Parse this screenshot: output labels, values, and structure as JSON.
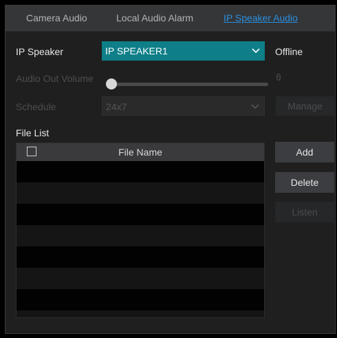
{
  "tabs": [
    {
      "label": "Camera Audio",
      "active": false
    },
    {
      "label": "Local Audio Alarm",
      "active": false
    },
    {
      "label": "IP Speaker Audio",
      "active": true
    }
  ],
  "ip_speaker": {
    "label": "IP Speaker",
    "value": "IP SPEAKER1",
    "status": "Offline"
  },
  "volume": {
    "label": "Audio Out Volume",
    "value": "0",
    "level_fraction": 0
  },
  "schedule": {
    "label": "Schedule",
    "value": "24x7",
    "manage_label": "Manage"
  },
  "file_list": {
    "label": "File List",
    "column_header": "File Name",
    "rows": [],
    "visible_empty_rows": 8
  },
  "actions": {
    "add": "Add",
    "delete": "Delete",
    "listen": "Listen"
  },
  "colors": {
    "accent_teal": "#0e7f88",
    "active_tab": "#2c8fe0"
  }
}
